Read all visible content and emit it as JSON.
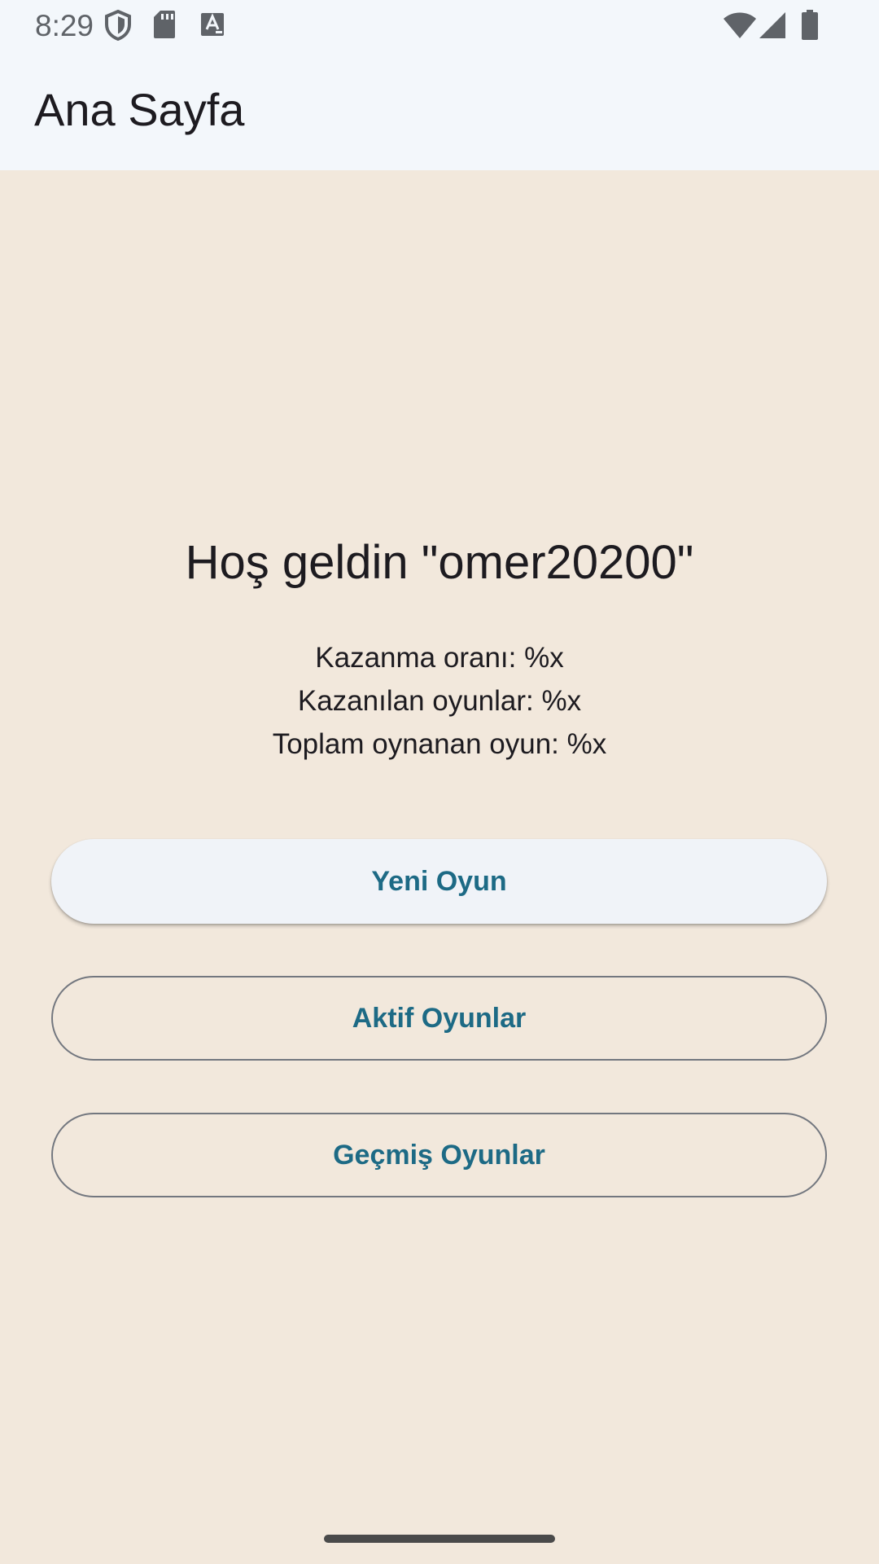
{
  "status_bar": {
    "time": "8:29",
    "icons_left": [
      "shield-icon",
      "sd-card-icon",
      "text-a-icon"
    ],
    "icons_right": [
      "wifi-icon",
      "cell-signal-icon",
      "battery-icon"
    ]
  },
  "app_bar": {
    "title": "Ana Sayfa"
  },
  "main": {
    "welcome_text": "Hoş geldin \"omer20200\"",
    "stats": {
      "win_rate": "Kazanma oranı: %x",
      "games_won": "Kazanılan oyunlar: %x",
      "total_games": "Toplam oynanan oyun: %x"
    },
    "buttons": {
      "new_game": "Yeni Oyun",
      "active_games": "Aktif Oyunlar",
      "past_games": "Geçmiş Oyunlar"
    }
  },
  "colors": {
    "background": "#f2e8dc",
    "app_bar": "#f3f7fb",
    "accent": "#1d6a85",
    "outline": "#73777f"
  }
}
